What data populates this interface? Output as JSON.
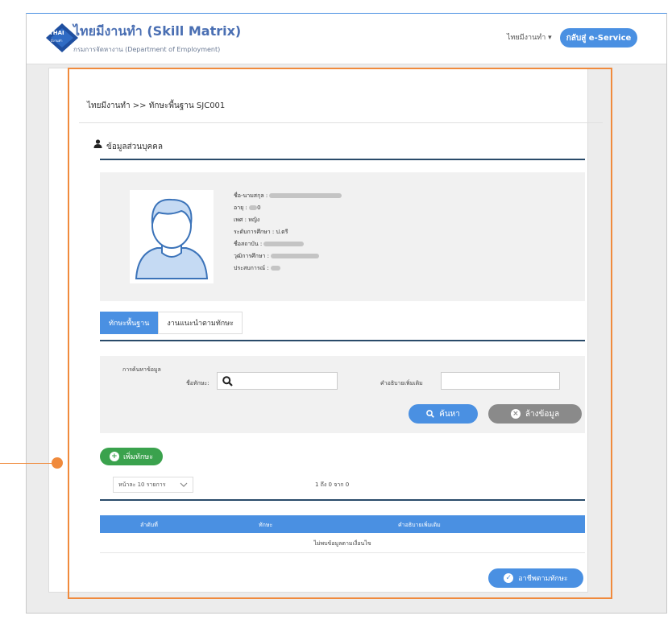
{
  "header": {
    "title": "ไทยมีงานทำ (Skill Matrix)",
    "subtitle": "กรมการจัดหางาน (Department of Employment)",
    "logo_text_top": "THAI",
    "logo_text_bottom": "มีงานทำ",
    "language": "ไทยมีงานทำ ▾",
    "back_button": "กลับสู่ e-Service"
  },
  "breadcrumb": "ไทยมีงานทำ >> ทักษะพื้นฐาน SJC001",
  "personal": {
    "section_title": "ข้อมูลส่วนบุคคล",
    "fields": [
      {
        "label": "ชื่อ-นามสกุล :",
        "value": ""
      },
      {
        "label": "อายุ :",
        "value": "0"
      },
      {
        "label": "เพศ :",
        "value": "หญิง"
      },
      {
        "label": "ระดับการศึกษา :",
        "value": "ป.ตรี"
      },
      {
        "label": "ชื่อสถาบัน :",
        "value": ""
      },
      {
        "label": "วุฒิการศึกษา :",
        "value": ""
      },
      {
        "label": "ประสบการณ์ :",
        "value": ""
      }
    ]
  },
  "tabs": [
    {
      "label": "ทักษะพื้นฐาน",
      "active": true
    },
    {
      "label": "งานแนะนำตามทักษะ",
      "active": false
    }
  ],
  "search": {
    "heading": "การค้นหาข้อมูล",
    "skill_label": "ชื่อทักษะ:",
    "desc_label": "คำอธิบายเพิ่มเติม",
    "search_button": "ค้นหา",
    "clear_button": "ล้างข้อมูล"
  },
  "add_button": "เพิ่มทักษะ",
  "pagination": {
    "per_page": "หน้าละ 10 รายการ",
    "range": "1 ถึง 0 จาก 0"
  },
  "table": {
    "headers": [
      "ลำดับที่",
      "ทักษะ",
      "คำอธิบายเพิ่มเติม"
    ],
    "empty_text": "ไม่พบข้อมูลตามเงื่อนไข"
  },
  "career_button": "อาชีพตามทักษะ",
  "colors": {
    "primary": "#4a90e2",
    "accent_orange": "#f08a3c",
    "add_green": "#3aa24d",
    "clear_gray": "#8a8a8a",
    "section_line": "#2a4b6a"
  }
}
